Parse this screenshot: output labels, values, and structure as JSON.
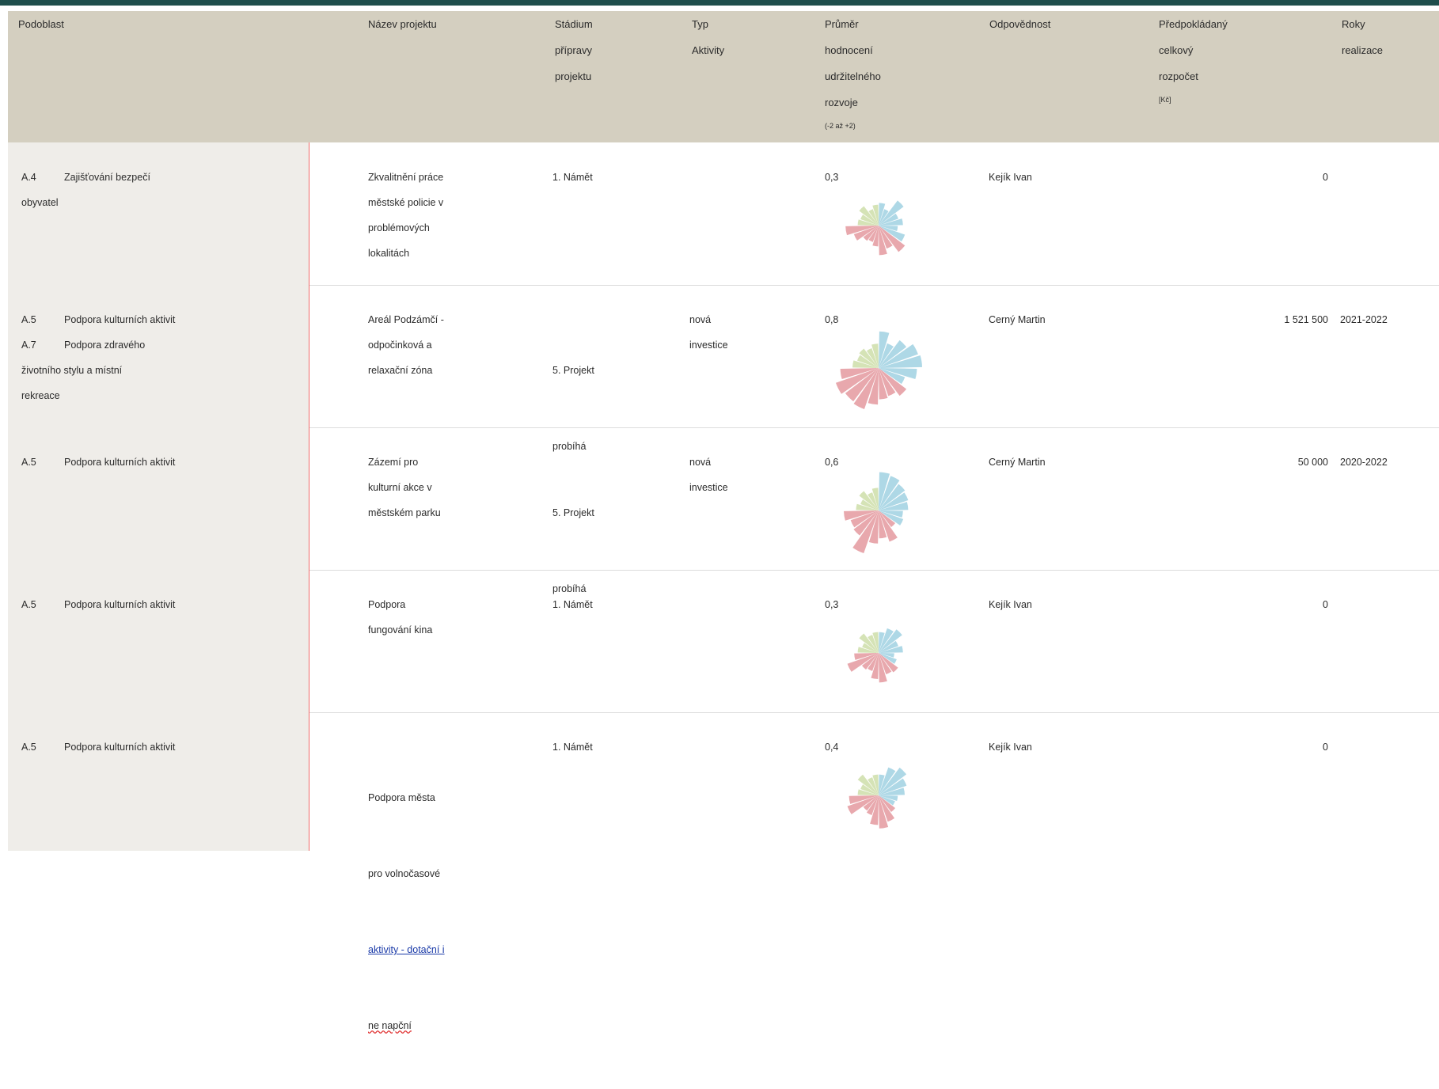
{
  "header": {
    "podoblast": "Podoblast",
    "nazev": "Název projektu",
    "stadium": [
      "Stádium",
      "přípravy",
      "projektu"
    ],
    "typ": [
      "Typ",
      "Aktivity"
    ],
    "prumer": [
      "Průměr",
      "hodnocení",
      "udržitelného",
      "rozvoje"
    ],
    "prumer_note": "(-2 až +2)",
    "odpovednost": "Odpovědnost",
    "rozpocet": [
      "Předpokládaný",
      "celkový",
      "rozpočet"
    ],
    "rozpocet_unit": "[Kč]",
    "roky": [
      "Roky",
      "realizace"
    ]
  },
  "rows": [
    {
      "areas": [
        [
          "A.4",
          "Zajišťování bezpečí"
        ],
        [
          "",
          "obyvatel"
        ]
      ],
      "name": [
        "Zkvalitnění práce",
        "městské policie v",
        "problémových",
        "lokalitách"
      ],
      "stage": [
        "1.   Námět"
      ],
      "type": [],
      "score": "0,3",
      "owner": "Kejík Ivan",
      "budget": "0",
      "years": "",
      "rose": [
        0.65,
        0.5,
        0.9,
        0.6,
        0.7,
        0.55,
        0.8,
        0.95,
        0.7,
        0.85,
        0.6,
        0.5,
        0.55,
        0.75,
        0.95,
        0.6,
        0.55,
        0.7,
        0.5,
        0.6
      ]
    },
    {
      "areas": [
        [
          "A.5",
          "Podpora kulturních aktivit"
        ],
        [
          "A.7",
          "Podpora zdravého"
        ],
        [
          "",
          "životního stylu a místní"
        ],
        [
          "",
          "rekreace"
        ]
      ],
      "name": [
        "Areál Podzámčí -",
        "odpočinková a",
        "relaxační zóna"
      ],
      "stage": [
        "5.   Projekt",
        "probíhá"
      ],
      "type": [
        "nová",
        "investice"
      ],
      "score": "0,8",
      "owner": "Cerný Martin",
      "budget": "1 521 500",
      "years": "2021-2022",
      "rose": [
        1.05,
        0.75,
        1.0,
        1.2,
        1.25,
        1.1,
        0.8,
        1.0,
        0.85,
        0.9,
        1.05,
        1.25,
        1.2,
        1.3,
        1.1,
        0.75,
        0.65,
        0.7,
        0.6,
        0.7
      ]
    },
    {
      "areas": [
        [
          "A.5",
          "Podpora kulturních aktivit"
        ]
      ],
      "name": [
        "Zázemí pro",
        "kulturní akce v",
        "městském parku"
      ],
      "stage": [
        "5.   Projekt",
        "probíhá"
      ],
      "type": [
        "nová",
        "investice"
      ],
      "score": "0,6",
      "owner": "Cerný Martin",
      "budget": "50 000",
      "years": "2020-2022",
      "rose": [
        1.1,
        1.05,
        0.95,
        0.9,
        0.85,
        0.7,
        0.75,
        0.6,
        0.95,
        0.8,
        0.95,
        1.3,
        0.9,
        0.85,
        1.0,
        0.65,
        0.55,
        0.7,
        0.55,
        0.65
      ]
    },
    {
      "areas": [
        [
          "A.5",
          "Podpora kulturních aktivit"
        ]
      ],
      "name": [
        "Podpora",
        "fungování kina"
      ],
      "stage": [
        "1.   Námět"
      ],
      "type": [],
      "score": "0,3",
      "owner": "Kejík Ivan",
      "budget": "0",
      "years": "",
      "rose": [
        0.6,
        0.75,
        0.85,
        0.6,
        0.7,
        0.45,
        0.55,
        0.7,
        0.65,
        0.85,
        0.75,
        0.55,
        0.6,
        0.95,
        0.7,
        0.6,
        0.5,
        0.7,
        0.55,
        0.6
      ]
    },
    {
      "areas": [
        [
          "A.5",
          "Podpora kulturních aktivit"
        ]
      ],
      "name": [
        "Podpora města",
        "pro volnočasové",
        "aktivity - dotační i",
        "ne   napční"
      ],
      "stage": [
        "1.   Námět"
      ],
      "type": [],
      "score": "0,4",
      "owner": "Kejík Ivan",
      "budget": "0",
      "years": "",
      "rose": [
        0.6,
        0.85,
        1.0,
        0.85,
        0.75,
        0.55,
        0.5,
        0.6,
        0.8,
        0.95,
        0.85,
        0.6,
        0.55,
        0.95,
        0.85,
        0.6,
        0.55,
        0.75,
        0.55,
        0.6
      ]
    }
  ],
  "colors": {
    "header_bg": "#d4cfc0",
    "left_bg": "#efede9",
    "divider_red": "#f06b6b",
    "petal_blue": "#aed8e6",
    "petal_red": "#e8a8ad",
    "petal_green": "#d5e3b6"
  }
}
